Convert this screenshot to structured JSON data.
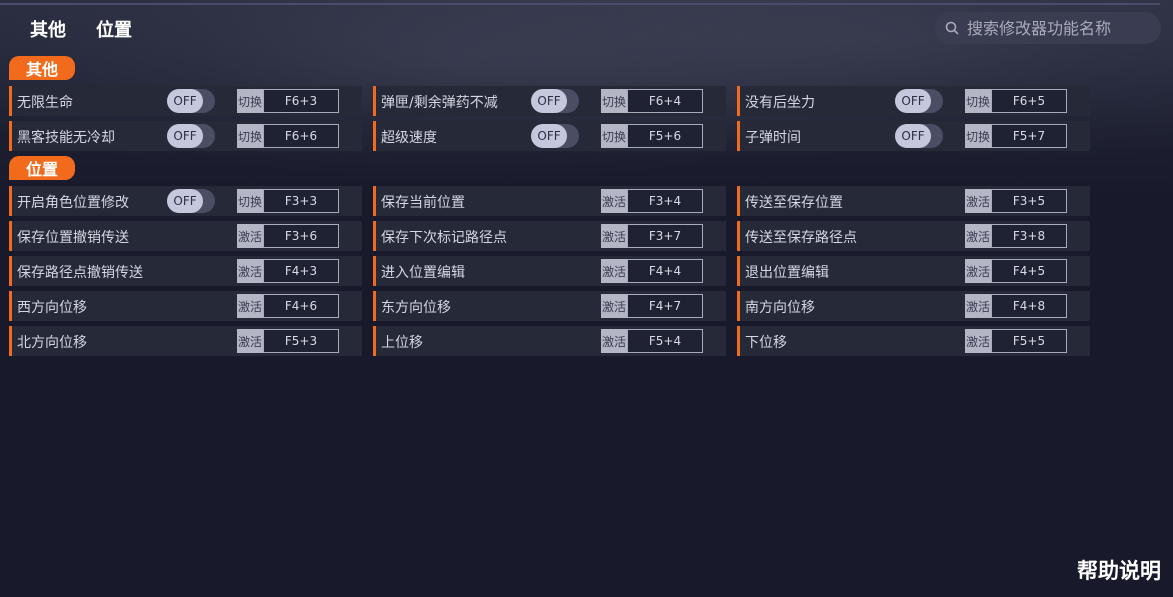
{
  "tabs": [
    "其他",
    "位置"
  ],
  "search": {
    "placeholder": "搜索修改器功能名称"
  },
  "sections": {
    "other": {
      "title": "其他",
      "items": [
        {
          "label": "无限生命",
          "toggle": "OFF",
          "mode": "切换",
          "key": "F6+3"
        },
        {
          "label": "弹匣/剩余弹药不减",
          "toggle": "OFF",
          "mode": "切换",
          "key": "F6+4"
        },
        {
          "label": "没有后坐力",
          "toggle": "OFF",
          "mode": "切换",
          "key": "F6+5"
        },
        {
          "label": "黑客技能无冷却",
          "toggle": "OFF",
          "mode": "切换",
          "key": "F6+6"
        },
        {
          "label": "超级速度",
          "toggle": "OFF",
          "mode": "切换",
          "key": "F5+6"
        },
        {
          "label": "子弹时间",
          "toggle": "OFF",
          "mode": "切换",
          "key": "F5+7"
        }
      ]
    },
    "position": {
      "title": "位置",
      "items": [
        {
          "label": "开启角色位置修改",
          "toggle": "OFF",
          "mode": "切换",
          "key": "F3+3"
        },
        {
          "label": "保存当前位置",
          "mode": "激活",
          "key": "F3+4"
        },
        {
          "label": "传送至保存位置",
          "mode": "激活",
          "key": "F3+5"
        },
        {
          "label": "保存位置撤销传送",
          "mode": "激活",
          "key": "F3+6"
        },
        {
          "label": "保存下次标记路径点",
          "mode": "激活",
          "key": "F3+7"
        },
        {
          "label": "传送至保存路径点",
          "mode": "激活",
          "key": "F3+8"
        },
        {
          "label": "保存路径点撤销传送",
          "mode": "激活",
          "key": "F4+3"
        },
        {
          "label": "进入位置编辑",
          "mode": "激活",
          "key": "F4+4"
        },
        {
          "label": "退出位置编辑",
          "mode": "激活",
          "key": "F4+5"
        },
        {
          "label": "西方向位移",
          "mode": "激活",
          "key": "F4+6"
        },
        {
          "label": "东方向位移",
          "mode": "激活",
          "key": "F4+7"
        },
        {
          "label": "南方向位移",
          "mode": "激活",
          "key": "F4+8"
        },
        {
          "label": "北方向位移",
          "mode": "激活",
          "key": "F5+3"
        },
        {
          "label": "上位移",
          "mode": "激活",
          "key": "F5+4"
        },
        {
          "label": "下位移",
          "mode": "激活",
          "key": "F5+5"
        }
      ]
    }
  },
  "help_label": "帮助说明",
  "colors": {
    "accent": "#f26b1d",
    "background": "#181a2b",
    "cell": "#262938"
  },
  "icons": {
    "search": "search-icon"
  }
}
